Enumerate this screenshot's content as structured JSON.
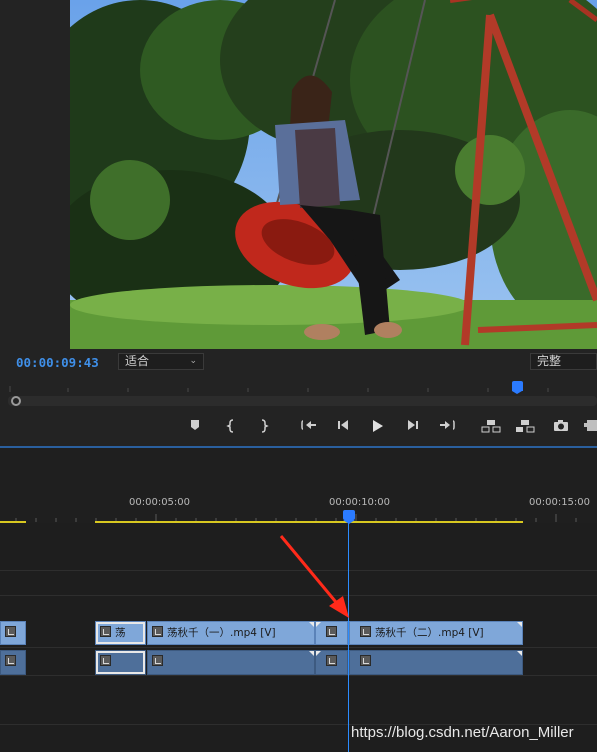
{
  "monitor": {
    "timecode": "00:00:09:43",
    "zoom_select": "适合",
    "quality_select": "完整"
  },
  "controls": [
    {
      "name": "add-marker-button",
      "icon": "marker-icon"
    },
    {
      "name": "mark-in-button",
      "icon": "mark-in-icon"
    },
    {
      "name": "mark-out-button",
      "icon": "mark-out-icon"
    },
    {
      "name": "go-to-in-button",
      "icon": "go-to-in-icon"
    },
    {
      "name": "step-back-button",
      "icon": "step-back-icon"
    },
    {
      "name": "play-button",
      "icon": "play-icon"
    },
    {
      "name": "step-forward-button",
      "icon": "step-forward-icon"
    },
    {
      "name": "go-to-out-button",
      "icon": "go-to-out-icon"
    },
    {
      "name": "lift-button",
      "icon": "lift-icon"
    },
    {
      "name": "extract-button",
      "icon": "extract-icon"
    },
    {
      "name": "export-frame-button",
      "icon": "camera-icon"
    }
  ],
  "timeline": {
    "ruler_labels": [
      "00:00:05:00",
      "00:00:10:00",
      "00:00:15:00"
    ],
    "video_clips": [
      {
        "label": ""
      },
      {
        "label": "荡"
      },
      {
        "label": "荡秋千（一）.mp4 [V]"
      },
      {
        "label": ""
      },
      {
        "label": "荡秋千（二）.mp4 [V]"
      }
    ]
  },
  "watermark": "https://blog.csdn.net/Aaron_Miller",
  "colors": {
    "timecode": "#3f8fe8",
    "playhead": "#2b7bff",
    "video_clip": "#7fa7d9",
    "audio_clip": "#4e6f9a",
    "work_area": "#d8c820",
    "arrow": "#ff2a1a"
  }
}
